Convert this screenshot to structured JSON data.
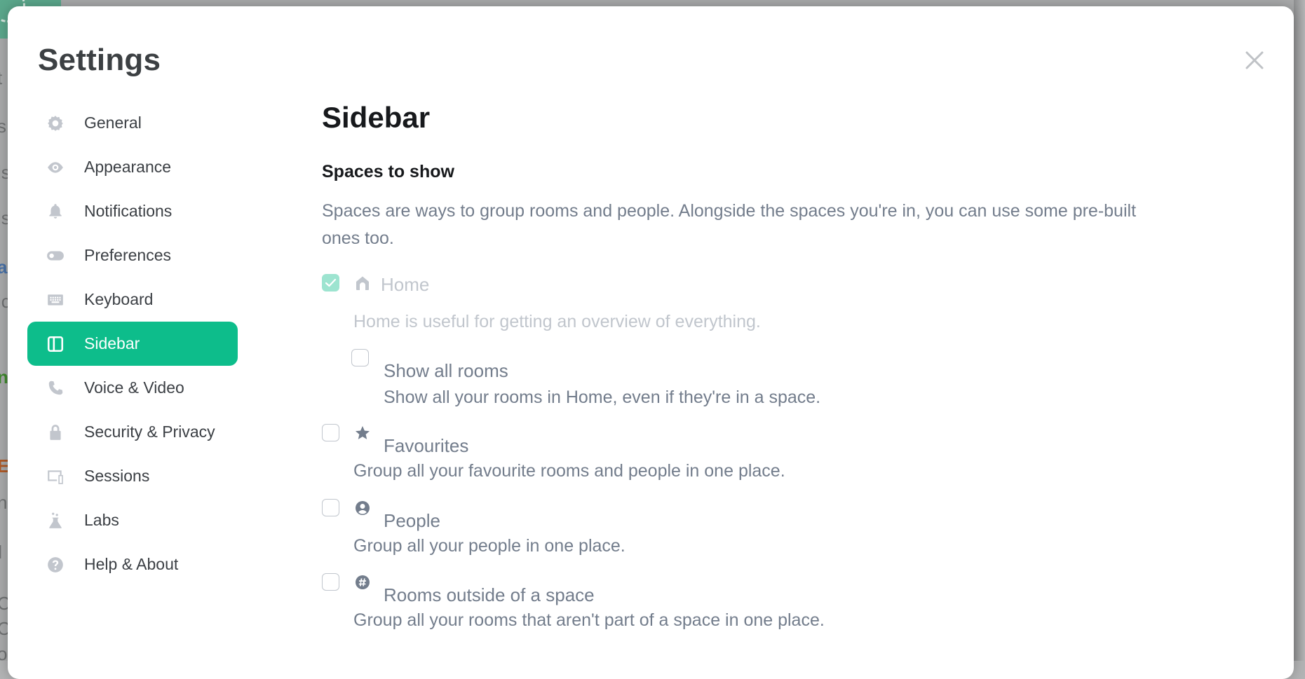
{
  "background": {
    "fragments": [
      "t",
      "s",
      "ls",
      "ls",
      "ar",
      "ic",
      "n",
      "E",
      "n",
      "l",
      "C",
      "C",
      "o"
    ]
  },
  "modal": {
    "title": "Settings",
    "close_label": "Close"
  },
  "nav": {
    "items": [
      {
        "label": "General",
        "icon": "gear-icon",
        "active": false
      },
      {
        "label": "Appearance",
        "icon": "eye-icon",
        "active": false
      },
      {
        "label": "Notifications",
        "icon": "bell-icon",
        "active": false
      },
      {
        "label": "Preferences",
        "icon": "toggle-icon",
        "active": false
      },
      {
        "label": "Keyboard",
        "icon": "keyboard-icon",
        "active": false
      },
      {
        "label": "Sidebar",
        "icon": "sidebar-icon",
        "active": true
      },
      {
        "label": "Voice & Video",
        "icon": "phone-icon",
        "active": false
      },
      {
        "label": "Security & Privacy",
        "icon": "lock-icon",
        "active": false
      },
      {
        "label": "Sessions",
        "icon": "devices-icon",
        "active": false
      },
      {
        "label": "Labs",
        "icon": "flask-icon",
        "active": false
      },
      {
        "label": "Help & About",
        "icon": "help-icon",
        "active": false
      }
    ]
  },
  "content": {
    "heading": "Sidebar",
    "section": {
      "heading": "Spaces to show",
      "description": "Spaces are ways to group rooms and people. Alongside the spaces you're in, you can use some pre-built ones too."
    },
    "options": [
      {
        "label": "Home",
        "icon": "home-icon",
        "description": "Home is useful for getting an overview of everything.",
        "checked": true,
        "disabled": true
      },
      {
        "label": "Show all rooms",
        "icon": "",
        "description": "Show all your rooms in Home, even if they're in a space.",
        "checked": false,
        "disabled": false
      },
      {
        "label": "Favourites",
        "icon": "star-icon",
        "description": "Group all your favourite rooms and people in one place.",
        "checked": false,
        "disabled": false
      },
      {
        "label": "People",
        "icon": "person-icon",
        "description": "Group all your people in one place.",
        "checked": false,
        "disabled": false
      },
      {
        "label": "Rooms outside of a space",
        "icon": "hash-icon",
        "description": "Group all your rooms that aren't part of a space in one place.",
        "checked": false,
        "disabled": false
      }
    ]
  },
  "colors": {
    "accent": "#0dbd8b",
    "secondary_text": "#737d8c",
    "primary_text": "#17191c",
    "icon_muted": "#c2c6cd"
  }
}
